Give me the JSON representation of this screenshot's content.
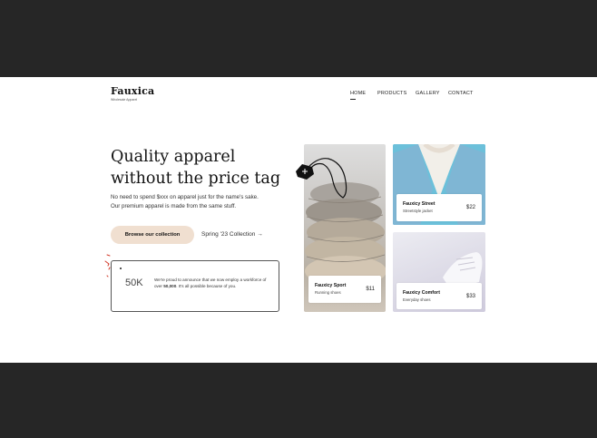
{
  "brand": {
    "name": "Fauxica",
    "tagline": "Wholesale Apparel"
  },
  "nav": {
    "items": [
      "HOME",
      "PRODUCTS",
      "GALLERY",
      "CONTACT"
    ],
    "active": "HOME"
  },
  "hero": {
    "headline_line1": "Quality apparel",
    "headline_line2": "without the price tag",
    "subtext_line1": "No need to spend $xxx on apparel just for the name's sake.",
    "subtext_line2": "Our premium apparel is made from the same stuff.",
    "cta_label": "Browse our collection",
    "secondary_link": "Spring '23 Collection →"
  },
  "stat": {
    "value": "50K",
    "text_before": "We're proud to announce that we now employ a workforce of over ",
    "text_bold": "50,000",
    "text_after": ". It's all possible because of you."
  },
  "products": [
    {
      "name": "Fauxicy Sport",
      "subtitle": "Running shoes",
      "price": "$11"
    },
    {
      "name": "Fauxicy Street",
      "subtitle": "Streetstyle jacket",
      "price": "$22"
    },
    {
      "name": "Fauxicy Comfort",
      "subtitle": "Everyday shoes",
      "price": "$33"
    }
  ],
  "colors": {
    "background_frame": "#262626",
    "cta_bg": "#f0dfd0",
    "accent_red": "#d23a2a"
  }
}
